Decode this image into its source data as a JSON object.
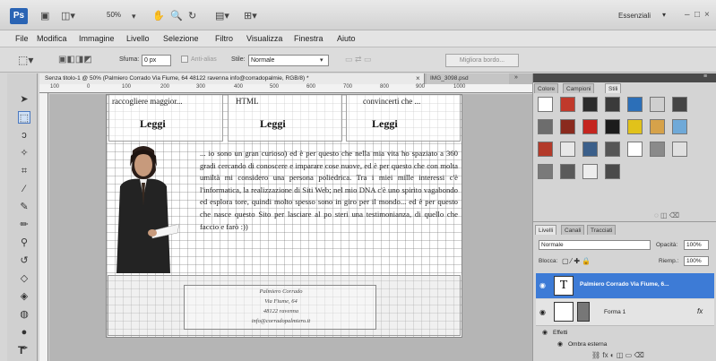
{
  "app": {
    "logo": "Ps",
    "zoom": "50%",
    "workspace": "Essenziali",
    "window_controls": {
      "minimize": "–",
      "maximize": "□",
      "close": "×"
    }
  },
  "menu": [
    "File",
    "Modifica",
    "Immagine",
    "Livello",
    "Selezione",
    "Filtro",
    "Visualizza",
    "Finestra",
    "Aiuto"
  ],
  "options": {
    "sfuma_label": "Sfuma:",
    "sfuma_value": "0 px",
    "antialias_label": "Anti-alias",
    "stile_label": "Stile:",
    "stile_value": "Normale",
    "migliora_button": "Migliora bordo..."
  },
  "tabs": {
    "active": "Senza titolo-1 @ 50% (Palmiero Corrado Via Fiume, 64 48122 ravenna info@corradopalmie, RGB/8) *",
    "second": "IMG_3098.psd"
  },
  "ruler_ticks": [
    "100",
    "0",
    "100",
    "200",
    "300",
    "400",
    "500",
    "600",
    "700",
    "800",
    "900",
    "1000"
  ],
  "document": {
    "columns": [
      {
        "top_text": "raccogliere maggior...",
        "button": "Leggi"
      },
      {
        "top_text": "HTML",
        "button": "Leggi"
      },
      {
        "top_text": "convincerti che ...",
        "button": "Leggi"
      }
    ],
    "bio": "... io sono un gran curioso) ed è per questo che nella mia vita ho spaziato a 360 gradi cercando di conoscere e imparare cose nuove, ed è per questo che con molta umiltà mi considero una persona poliedrica. Tra i miei mille interessi c'è l'informatica, la realizzazione di Siti Web; nel mio DNA c'è uno spirito vagabondo ed esplora tore, quindi molto spesso sono in giro per il mondo... ed è per questo che nasce questo Sito per lasciare al po steri una testimonianza, di quello che faccio e farò :))",
    "footer_lines": [
      "Palmiero Corrado",
      "Via Fiume, 64",
      "48122 ravenna",
      "info@corradopalmiero.it"
    ]
  },
  "style_panel": {
    "tabs": [
      "Colore",
      "Campioni",
      "Stili"
    ],
    "active_tab": "Stili",
    "swatch_colors": [
      "#ffffff",
      "#c0392b",
      "#2b2b2b",
      "#3a3a3a",
      "#2c6fb8",
      "#cfcfcf",
      "#444444",
      "#6d6d6d",
      "#8a2a1e",
      "#c4251f",
      "#1c1c1c",
      "#e1c21a",
      "#d6a24a",
      "#6fa9d8",
      "#b33a2a",
      "#e8e8e8",
      "#3b5f8a",
      "#565656",
      "#ffffff",
      "#8a8a8a",
      "#e0e0e0",
      "#7a7a7a",
      "#5a5a5a",
      "#ededed",
      "#4a4a4a"
    ]
  },
  "layers_panel": {
    "tabs": [
      "Livelli",
      "Canali",
      "Tracciati"
    ],
    "active_tab": "Livelli",
    "blend_mode": "Normale",
    "opacity_label": "Opacità:",
    "opacity_value": "100%",
    "lock_label": "Blocca:",
    "fill_label": "Riemp.:",
    "fill_value": "100%",
    "layers": [
      {
        "thumb": "T",
        "name": "Palmiero Corrado Via Fiume, 6...",
        "selected": true
      },
      {
        "thumb": "",
        "name": "Forma 1",
        "selected": false,
        "fx": "fx"
      }
    ],
    "effects_label": "Effetti",
    "effect_item": "Ombra esterna"
  }
}
